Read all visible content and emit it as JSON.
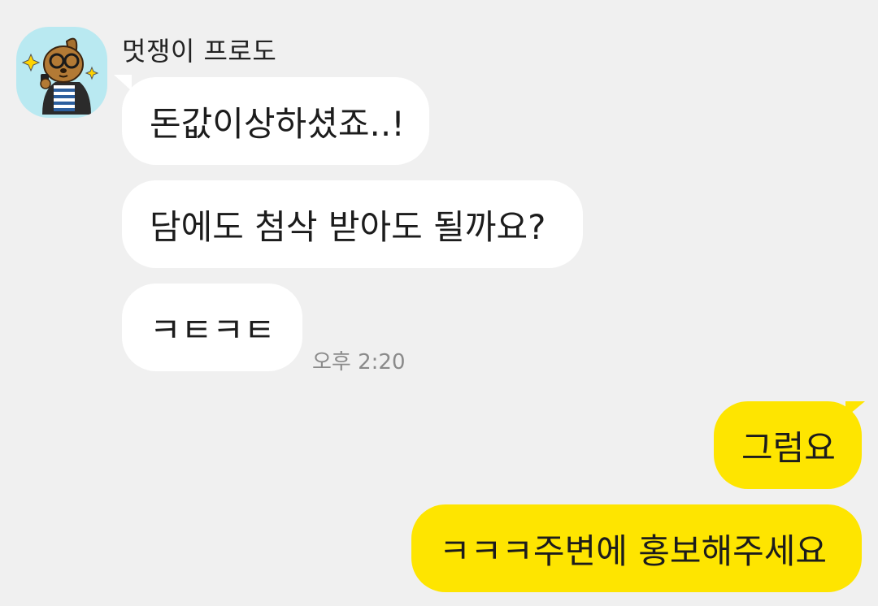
{
  "chat": {
    "sender": {
      "name": "멋쟁이 프로도",
      "avatar_icon": "frodo-dog-character-avatar"
    },
    "incoming_messages": [
      {
        "text": "돈값이상하셨죠..!"
      },
      {
        "text": "담에도 첨삭 받아도 될까요?"
      },
      {
        "text": "ㅋㅌㅋㅌ"
      }
    ],
    "incoming_time": "오후 2:20",
    "outgoing_messages": [
      {
        "text": "그럼요"
      },
      {
        "text": "ㅋㅋㅋ주변에 홍보해주세요"
      }
    ],
    "colors": {
      "background": "#f0f0f0",
      "incoming_bubble": "#ffffff",
      "outgoing_bubble": "#fee500",
      "avatar_bg": "#b9e9f1",
      "timestamp": "#8a8a8a"
    }
  }
}
